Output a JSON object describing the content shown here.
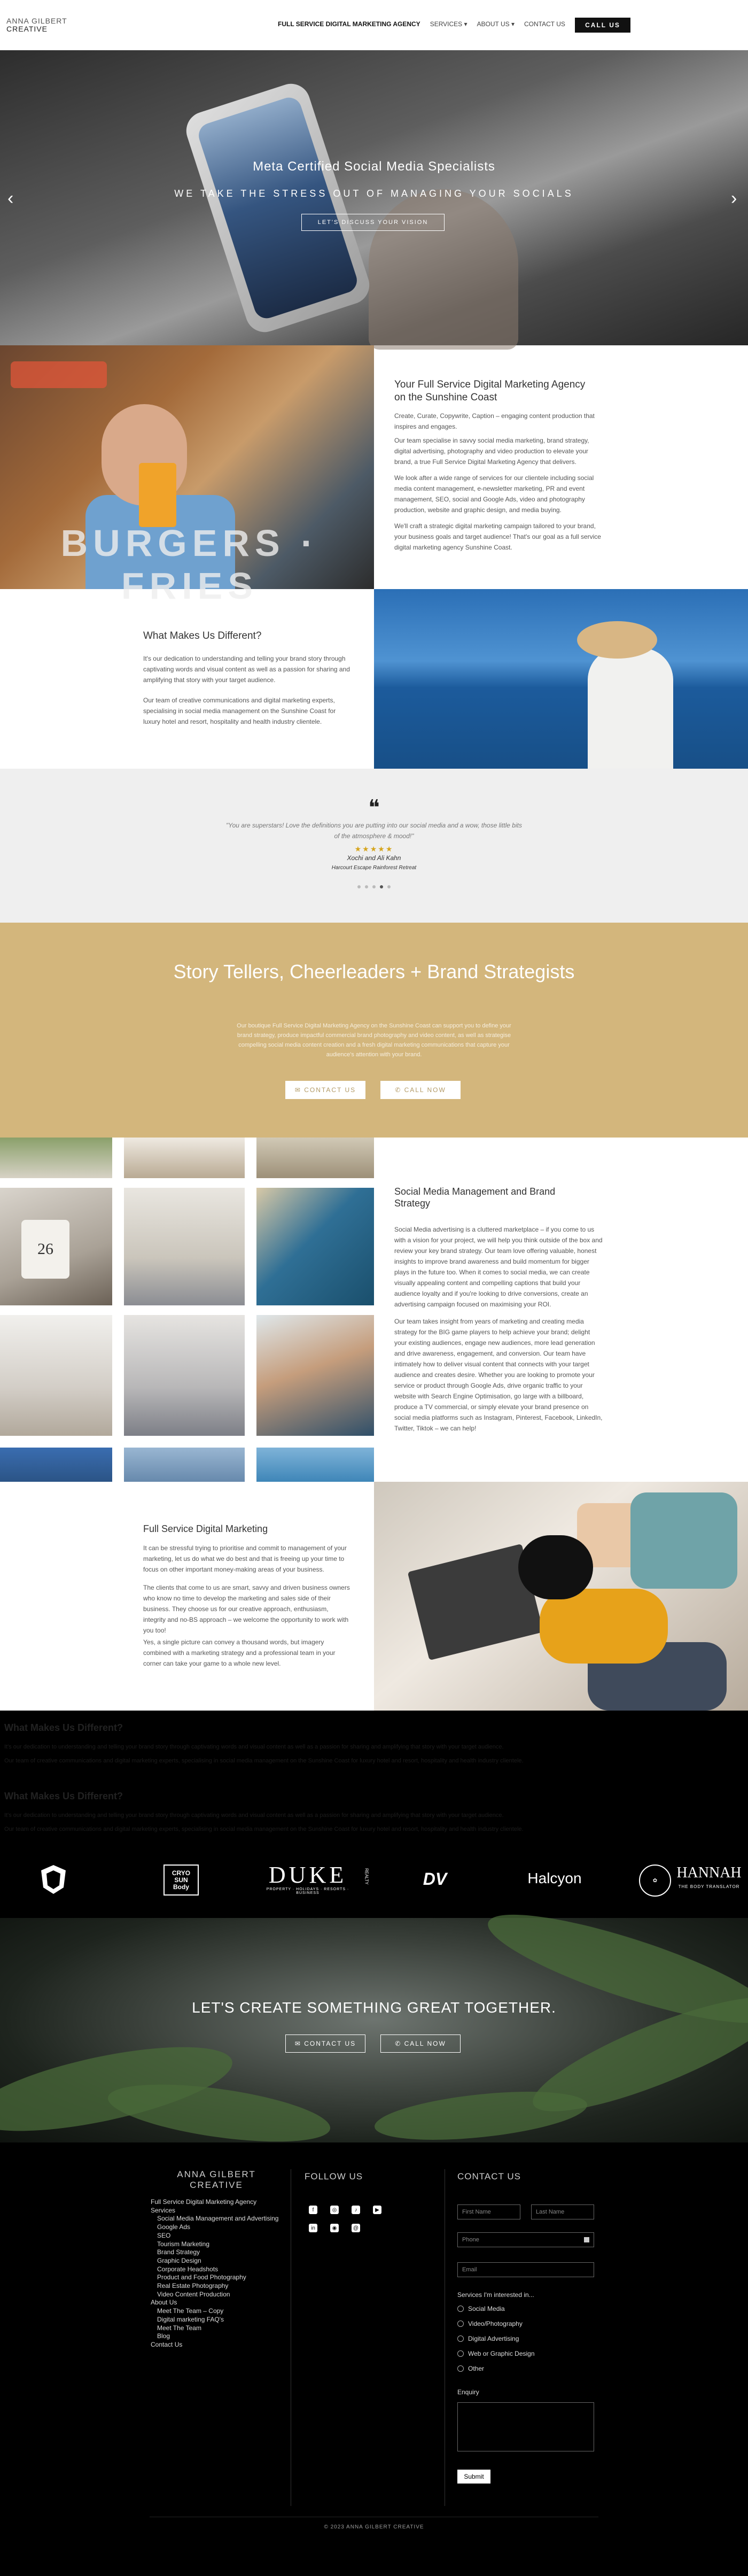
{
  "header": {
    "logo_line1": "ANNA GILBERT",
    "logo_line2": "CREATIVE",
    "nav": [
      "FULL SERVICE DIGITAL MARKETING AGENCY",
      "SERVICES ▾",
      "ABOUT US ▾",
      "CONTACT US"
    ],
    "call_label": "CALL US"
  },
  "hero": {
    "title": "Meta Certified Social Media Specialists",
    "subtitle": "WE TAKE THE STRESS OUT OF MANAGING YOUR SOCIALS",
    "button": "LET'S DISCUSS YOUR VISION",
    "prev": "‹",
    "next": "›"
  },
  "intro": {
    "heading": "Your Full Service Digital Marketing Agency on the Sunshine Coast",
    "paragraphs": [
      "Create, Curate, Copywrite, Caption – engaging content production that inspires and engages.",
      "Our team specialise in savvy social media marketing, brand strategy, digital advertising, photography and video production to elevate your brand, a true Full Service Digital Marketing Agency that delivers.",
      "We look after a wide range of services for our clientele including social media content management, e-newsletter marketing, PR and event management, SEO, social and Google Ads, video and photography production, website and graphic design, and media buying.",
      "We'll craft a strategic digital marketing campaign tailored to your brand, your business goals and target audience! That's our goal as a full service digital marketing agency Sunshine Coast."
    ]
  },
  "different": {
    "heading": "What Makes Us Different?",
    "paragraphs": [
      "It's our dedication to understanding and telling your brand story through captivating words and visual content as well as a passion for sharing and amplifying that story with your target audience.",
      "Our team of creative communications and digital marketing experts, specialising in social media management on the Sunshine Coast for luxury hotel and resort, hospitality and health industry clientele."
    ]
  },
  "testimonial": {
    "mark": "❝",
    "quote": "\"You are superstars! Love the definitions you are putting into our social media and a wow, those little bits of the atmosphere & mood!\"",
    "stars": "★★★★★",
    "name": "Xochi and Ali Kahn",
    "org": "Harcourt Escape Rainforest Retreat"
  },
  "gold": {
    "title": "Story Tellers, Cheerleaders + Brand Strategists",
    "text": "Our boutique Full Service Digital Marketing Agency on the Sunshine Coast can support you to define your brand strategy, produce impactful commercial brand photography and video content, as well as strategise compelling social media content creation and a fresh digital marketing communications that capture your audience's attention with your brand.",
    "contact": "✉ CONTACT US",
    "call": "✆ CALL NOW",
    "accent": "#d3b67c"
  },
  "smm": {
    "heading": "Social Media Management and Brand Strategy",
    "paragraphs": [
      "Social Media advertising is a cluttered marketplace – if you come to us with a vision for your project, we will help you think outside of the box and review your key brand strategy. Our team love offering valuable, honest insights to improve brand awareness and build momentum for bigger plays in the future too. When it comes to social media, we can create visually appealing content and compelling captions that build your audience loyalty and if you're looking to drive conversions, create an advertising campaign focused on maximising your ROI.",
      "Our team takes insight from years of marketing and creating media strategy for the BIG game players to help achieve your brand; delight your existing audiences, engage new audiences, more lead generation and drive awareness, engagement, and conversion. Our team have intimately how to deliver visual content that connects with your target audience and creates desire. Whether you are looking to promote your service or product through Google Ads, drive organic traffic to your website with Search Engine Optimisation, go large with a billboard, produce a TV commercial, or simply elevate your brand presence on social media platforms such as Instagram, Pinterest, Facebook, LinkedIn, Twitter, Tiktok – we can help!"
    ],
    "cup_text": "26"
  },
  "fullservice": {
    "heading": "Full Service Digital Marketing",
    "paragraphs": [
      "It can be stressful trying to prioritise and commit to management of your marketing, let us do what we do best and that is freeing up your time to focus on other important money-making areas of your business.",
      "The clients that come to us are smart, savvy and driven business owners who know no time to develop the marketing and sales side of their business. They choose us for our creative approach, enthusiasm, integrity and no-BS approach – we welcome the opportunity to work with you too!",
      "Yes, a single picture can convey a thousand words, but imagery combined with a marketing strategy and a professional team in your corner can take your game to a whole new level."
    ]
  },
  "black": {
    "heading": "What Makes Us Different?",
    "p1": "It's our dedication to understanding and telling your brand story through captivating words and visual content as well as a passion for sharing and amplifying that story with your target audience.",
    "p2": "Our team of creative communications and digital marketing experts, specialising in social media management on the Sunshine Coast for luxury hotel and resort, hospitality and health industry clientele."
  },
  "logos": {
    "l2": "CRYO\nSUN\nBody",
    "l3": "DUKE",
    "l3b": "PROPERTY · HOLIDAYS · RESORTS · BUSINESS",
    "l3c": "REALTY",
    "l4": "DV",
    "l5": "Halcyon",
    "l6": "HANNAH",
    "l6b": "THE BODY TRANSLATOR"
  },
  "cta": {
    "heading": "LET'S CREATE SOMETHING GREAT TOGETHER.",
    "contact": "✉ CONTACT US",
    "call": "✆ CALL NOW"
  },
  "footer": {
    "logo_line1": "ANNA GILBERT",
    "logo_line2": "CREATIVE",
    "links": [
      {
        "t": "Full Service Digital Marketing Agency",
        "s": false
      },
      {
        "t": "Services",
        "s": false
      },
      {
        "t": "Social Media Management and Advertising",
        "s": true
      },
      {
        "t": "Google Ads",
        "s": true
      },
      {
        "t": "SEO",
        "s": true
      },
      {
        "t": "Tourism Marketing",
        "s": true
      },
      {
        "t": "Brand Strategy",
        "s": true
      },
      {
        "t": "Graphic Design",
        "s": true
      },
      {
        "t": "Corporate Headshots",
        "s": true
      },
      {
        "t": "Product and Food Photography",
        "s": true
      },
      {
        "t": "Real Estate Photography",
        "s": true
      },
      {
        "t": "Video Content Production",
        "s": true
      },
      {
        "t": "About Us",
        "s": false
      },
      {
        "t": "Meet The Team – Copy",
        "s": true
      },
      {
        "t": "Digital marketing FAQ's",
        "s": true
      },
      {
        "t": "Meet The Team",
        "s": true
      },
      {
        "t": "Blog",
        "s": true
      },
      {
        "t": "Contact Us",
        "s": false
      }
    ],
    "follow": "FOLLOW US",
    "contact": "CONTACT US",
    "first": "First Name",
    "last": "Last Name",
    "phone": "Phone",
    "email": "Email",
    "services_label": "Services I'm interested in...",
    "services": [
      "Social Media",
      "Video/Photography",
      "Digital Advertising",
      "Web or Graphic Design",
      "Other"
    ],
    "enquiry": "Enquiry",
    "submit": "Submit",
    "copyright": "© 2023 ANNA GILBERT CREATIVE"
  }
}
